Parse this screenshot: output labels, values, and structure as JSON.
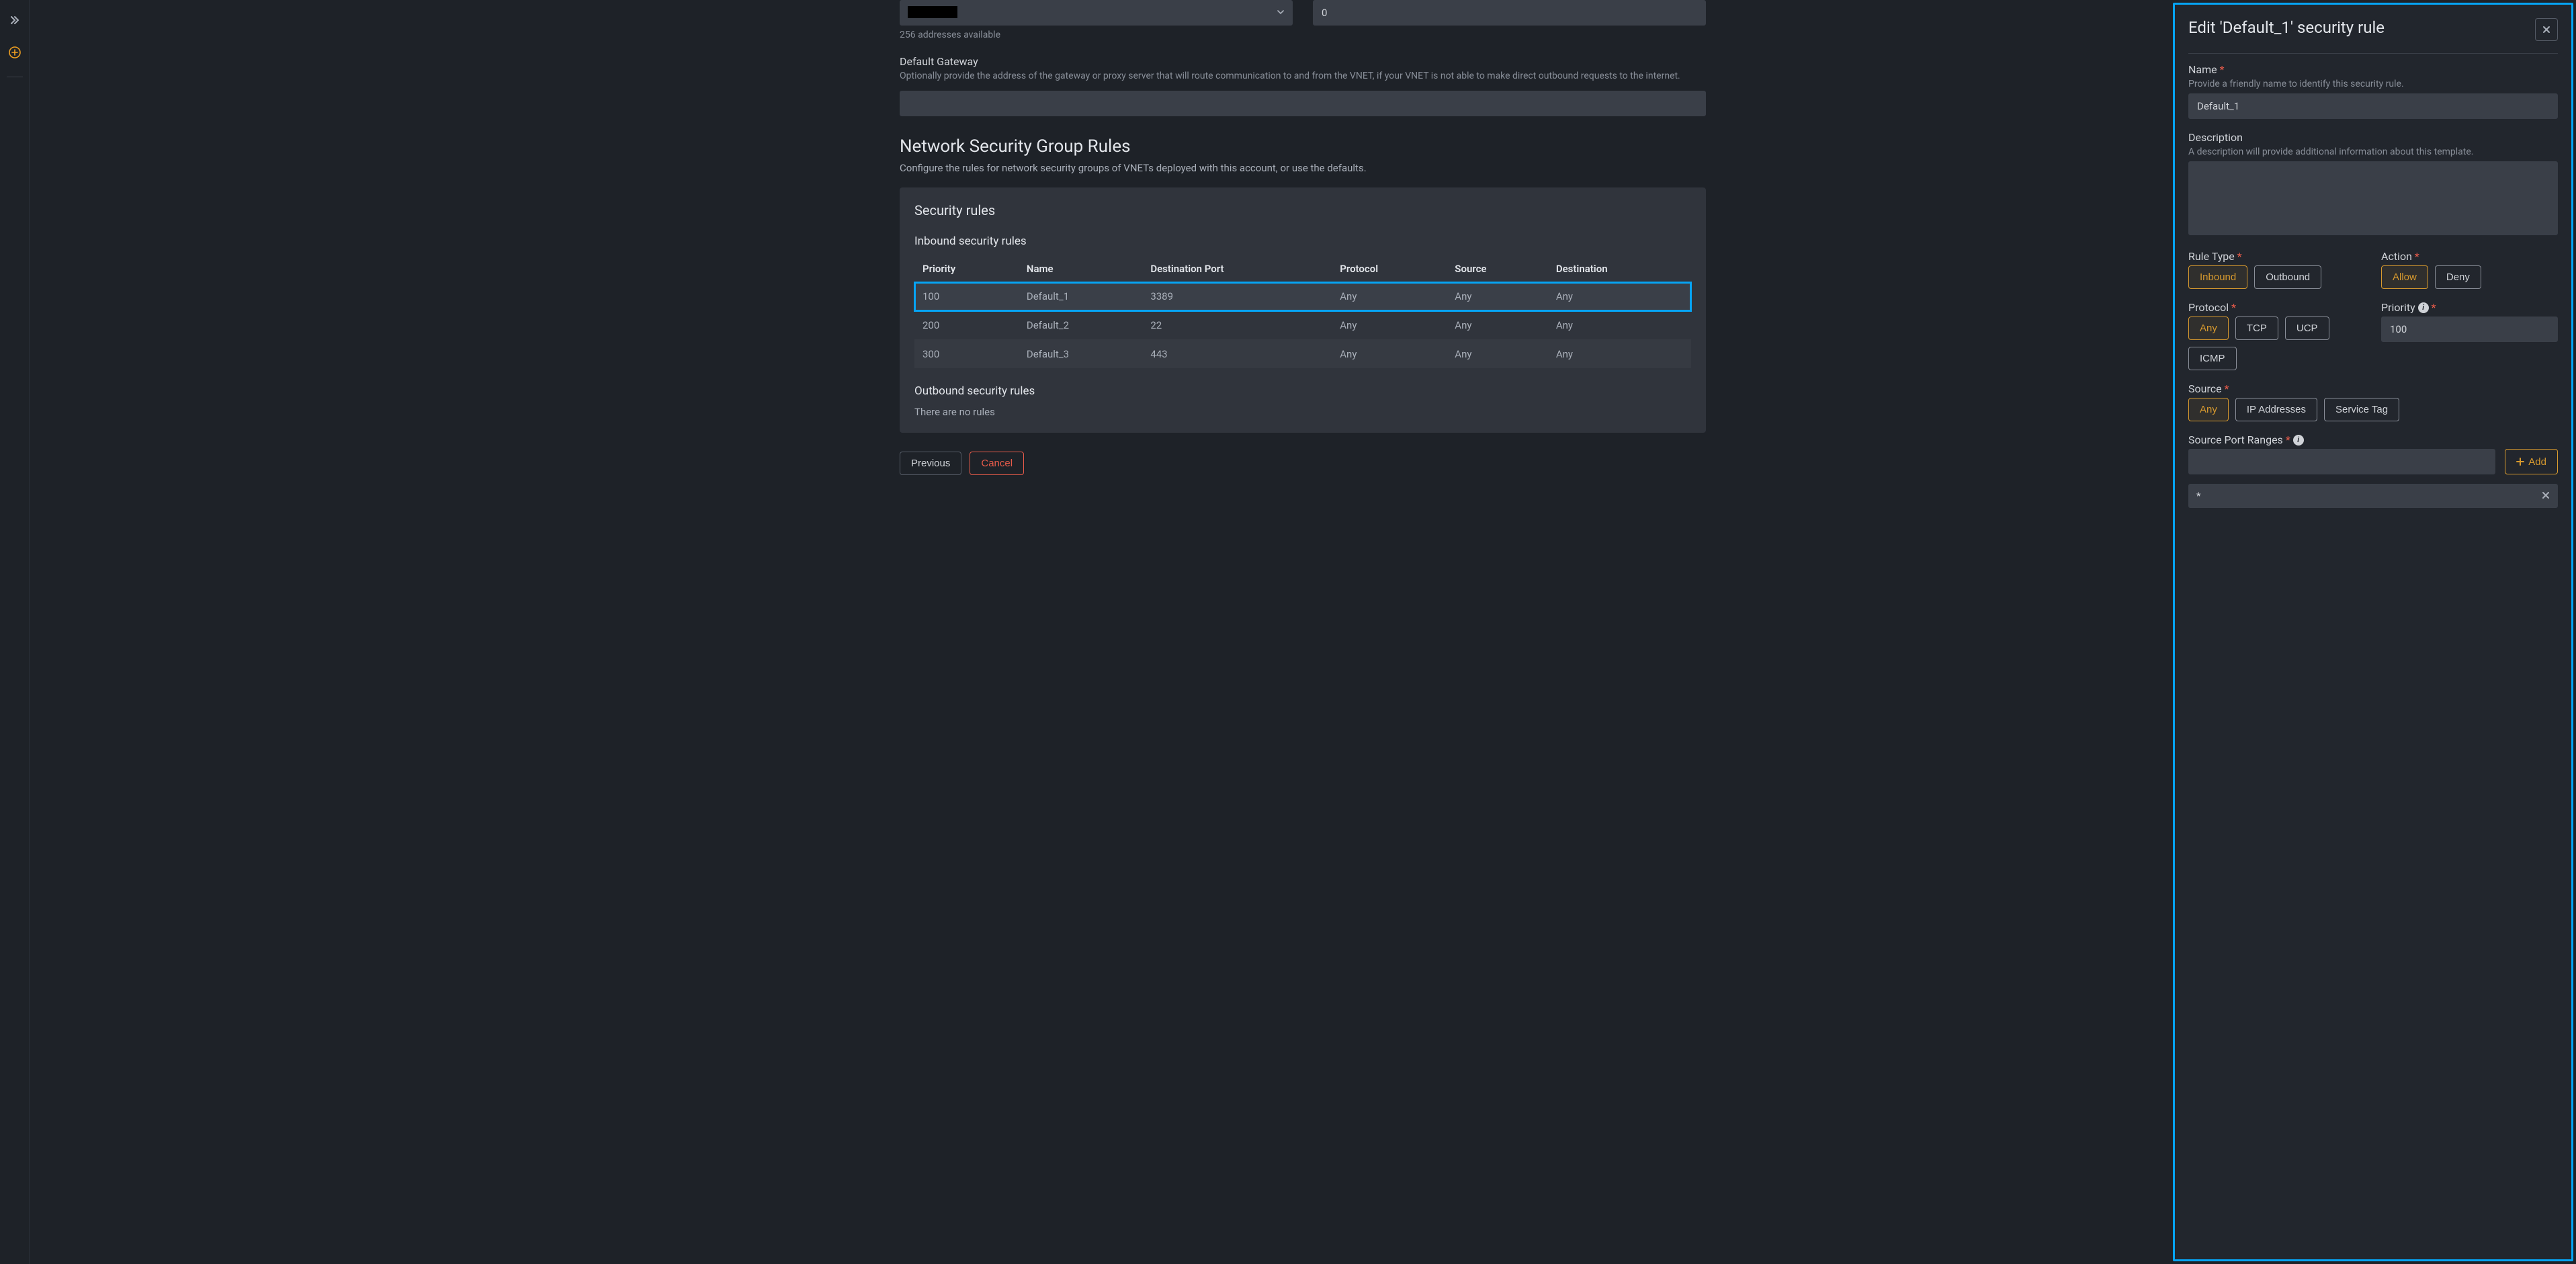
{
  "sidebar": {
    "expand_tip": "Expand",
    "add_tip": "Add"
  },
  "addrSpace": {
    "value": "███████",
    "helper": "256 addresses available"
  },
  "maxNum": {
    "value": "0"
  },
  "gateway": {
    "label": "Default Gateway",
    "desc": "Optionally provide the address of the gateway or proxy server that will route communication to and from the VNET, if your VNET is not able to make direct outbound requests to the internet.",
    "value": ""
  },
  "nsg": {
    "heading": "Network Security Group Rules",
    "sub": "Configure the rules for network security groups of VNETs deployed with this account, or use the defaults.",
    "panelTitle": "Security rules",
    "inboundTitle": "Inbound security rules",
    "outboundTitle": "Outbound security rules",
    "noRules": "There are no rules",
    "columns": [
      "Priority",
      "Name",
      "Destination Port",
      "Protocol",
      "Source",
      "Destination"
    ],
    "inbound": [
      {
        "priority": "100",
        "name": "Default_1",
        "port": "3389",
        "protocol": "Any",
        "source": "Any",
        "dest": "Any",
        "selected": true
      },
      {
        "priority": "200",
        "name": "Default_2",
        "port": "22",
        "protocol": "Any",
        "source": "Any",
        "dest": "Any",
        "selected": false
      },
      {
        "priority": "300",
        "name": "Default_3",
        "port": "443",
        "protocol": "Any",
        "source": "Any",
        "dest": "Any",
        "selected": false
      }
    ]
  },
  "footer": {
    "previous": "Previous",
    "cancel": "Cancel"
  },
  "drawer": {
    "title": "Edit 'Default_1' security rule",
    "name": {
      "label": "Name",
      "desc": "Provide a friendly name to identify this security rule.",
      "value": "Default_1"
    },
    "description": {
      "label": "Description",
      "desc": "A description will provide additional information about this template.",
      "value": ""
    },
    "ruleType": {
      "label": "Rule Type",
      "options": [
        "Inbound",
        "Outbound"
      ],
      "active": "Inbound"
    },
    "action": {
      "label": "Action",
      "options": [
        "Allow",
        "Deny"
      ],
      "active": "Allow"
    },
    "protocol": {
      "label": "Protocol",
      "options": [
        "Any",
        "TCP",
        "UCP",
        "ICMP"
      ],
      "active": "Any"
    },
    "priority": {
      "label": "Priority",
      "value": "100"
    },
    "source": {
      "label": "Source",
      "options": [
        "Any",
        "IP Addresses",
        "Service Tag"
      ],
      "active": "Any"
    },
    "sourcePorts": {
      "label": "Source Port Ranges",
      "addLabel": "Add",
      "items": [
        "*"
      ]
    }
  }
}
